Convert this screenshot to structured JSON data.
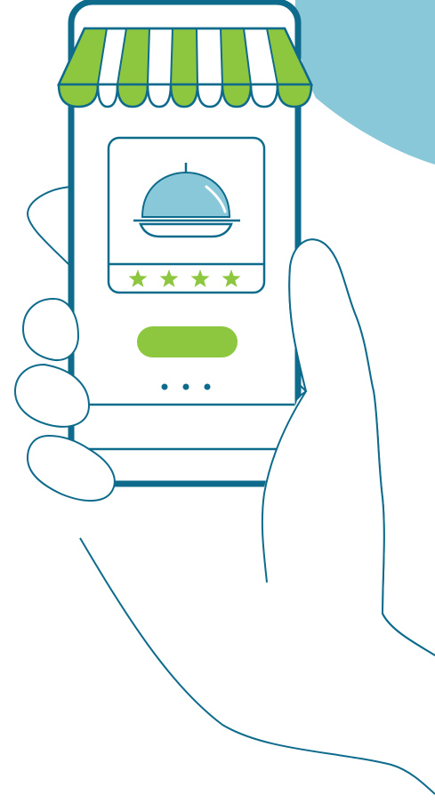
{
  "colors": {
    "outline": "#0f6b8c",
    "accent_green": "#8dc63f",
    "accent_blue": "#89c8d8",
    "background": "#ffffff"
  },
  "rating": {
    "stars_filled": 4,
    "stars_total": 4
  },
  "screen": {
    "dots_count": 3
  },
  "icons": {
    "cloche": "food-cloche-icon",
    "awning": "store-awning-icon",
    "star": "star-icon",
    "hand": "hand-illustration"
  }
}
